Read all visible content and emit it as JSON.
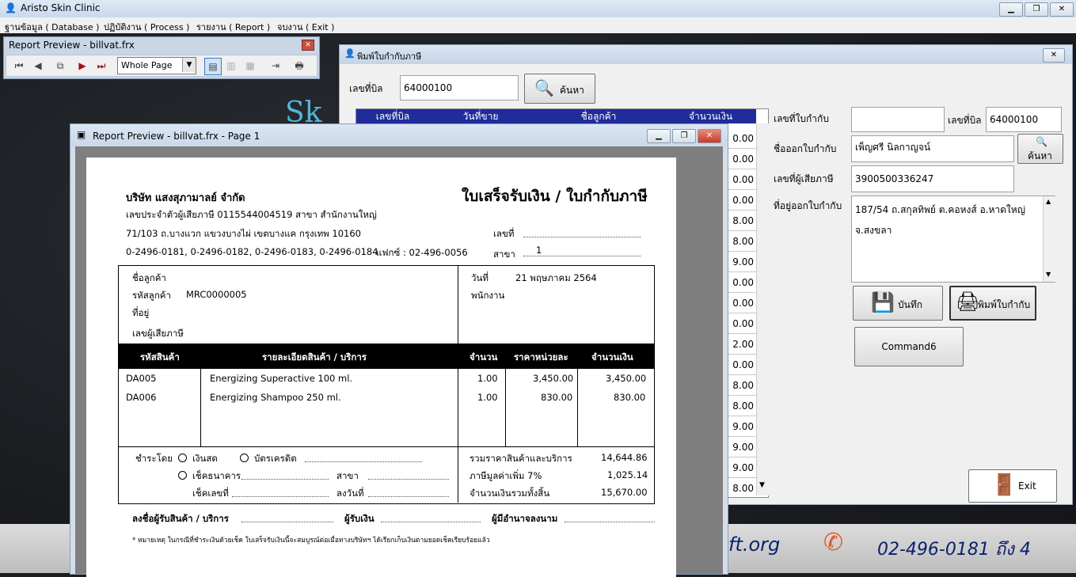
{
  "app": {
    "title": "Aristo Skin Clinic",
    "menu": [
      "ฐานข้อมูล ( Database )",
      "ปฏิบัติงาน ( Process )",
      "รายงาน ( Report )",
      "จบงาน ( Exit )"
    ]
  },
  "toolbar_window": {
    "title": "Report Preview - billvat.frx",
    "zoom_value": "Whole Page"
  },
  "form": {
    "title": "พิมพ์ใบกำกับภาษี",
    "bill_no_label": "เลขที่บิล",
    "bill_no_value": "64000100",
    "search_label": "ค้นหา",
    "grid_headers": [
      "เลขที่บิล",
      "วันที่ขาย",
      "ชื่อลูกค้า",
      "จำนวนเงิน"
    ],
    "grid_values": [
      "0.00",
      "0.00",
      "0.00",
      "0.00",
      "8.00",
      "8.00",
      "9.00",
      "0.00",
      "0.00",
      "0.00",
      "2.00",
      "0.00",
      "8.00",
      "8.00",
      "9.00",
      "9.00",
      "9.00",
      "8.00"
    ],
    "tax_invoice_no_label": "เลขที่ใบกำกับ",
    "tax_invoice_no_value": "",
    "bill_no_label2": "เลขที่บิล",
    "bill_no_value2": "64000100",
    "issued_name_label": "ชื่อออกใบกำกับ",
    "issued_name_value": "เพ็ญศรี นิลกาญจน์",
    "search_small_label": "ค้นหา",
    "taxpayer_label": "เลขที่ผู้เสียภาษี",
    "taxpayer_value": "3900500336247",
    "address_label": "ที่อยู่ออกใบกำกับ",
    "address_value": "187/54 ถ.สกุลทิพย์ ต.คอหงส์ อ.หาดใหญ่ จ.สงขลา",
    "save_label": "บันทึก",
    "print_label": "พิมพ์ใบกำกับ",
    "command6_label": "Command6",
    "exit_label": "Exit"
  },
  "report_window": {
    "title": "Report Preview - billvat.frx - Page 1"
  },
  "invoice": {
    "company": "บริษัท แสงสุภามาลย์ จำกัด",
    "doc_title": "ใบเสร็จรับเงิน / ใบกำกับภาษี",
    "tax_id_line": "เลขประจำตัวผู้เสียภาษี 0115544004519  สาขา สำนักงานใหญ่",
    "address_line": "71/103 ถ.บางแวก แขวงบางไผ่ เขตบางแค กรุงเทพ 10160",
    "phone_line": "0-2496-0181, 0-2496-0182, 0-2496-0183, 0-2496-0184",
    "fax_line": "แฟกซ์ : 02-496-0056",
    "no_label": "เลขที่",
    "branch_label": "สาขา",
    "branch_value": "1",
    "customer_label": "ชื่อลูกค้า",
    "customer_code_label": "รหัสลูกค้า",
    "customer_code_value": "MRC0000005",
    "address_label": "ที่อยู่",
    "taxpayer_label": "เลขผู้เสียภาษี",
    "date_label": "วันที่",
    "date_value": "21 พฤษภาคม 2564",
    "staff_label": "พนักงาน",
    "columns": [
      "รหัสสินค้า",
      "รายละเอียดสินค้า / บริการ",
      "จำนวน",
      "ราคาหน่วยละ",
      "จำนวนเงิน"
    ],
    "items": [
      {
        "code": "DA005",
        "desc": "Energizing Superactive 100 ml.",
        "qty": "1.00",
        "price": "3,450.00",
        "amount": "3,450.00"
      },
      {
        "code": "DA006",
        "desc": "Energizing Shampoo 250 ml.",
        "qty": "1.00",
        "price": "830.00",
        "amount": "830.00"
      }
    ],
    "pay_by_label": "ชำระโดย",
    "cash_label": "เงินสด",
    "credit_label": "บัตรเครดิต",
    "cheque_label": "เช็คธนาคาร",
    "branch2_label": "สาขา",
    "cheque_no_label": "เช็คเลขที่",
    "date2_label": "ลงวันที่",
    "subtotal_label": "รวมราคาสินค้าและบริการ",
    "subtotal_value": "14,644.86",
    "vat_label": "ภาษีมูลค่าเพิ่ม 7%",
    "vat_value": "1,025.14",
    "total_label": "จำนวนเงินรวมทั้งสิ้น",
    "total_value": "15,670.00",
    "sign_seller": "ลงชื่อผู้รับสินค้า / บริการ",
    "sign_receiver": "ผู้รับเงิน",
    "sign_auth": "ผู้มีอำนาจลงนาม",
    "note": "* หมายเหตุ  ในกรณีที่ชำระเงินด้วยเช็ค  ใบเสร็จรับเงินนี้จะสมบูรณ์ต่อเมื่อทางบริษัทฯ  ได้เรียกเก็บเงินตามยอดเช็คเรียบร้อยแล้ว"
  },
  "background": {
    "url_fragment": "ft.org",
    "phone": "02-496-0181 ถึง 4"
  }
}
